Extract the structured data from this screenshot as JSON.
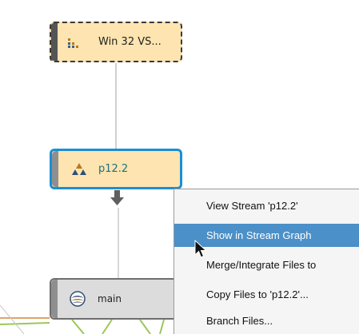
{
  "graph": {
    "nodes": [
      {
        "id": "win32",
        "label": "Win 32 VS...",
        "icon": "stream-workspace-icon"
      },
      {
        "id": "p12",
        "label": "p12.2",
        "icon": "stream-development-icon"
      },
      {
        "id": "main",
        "label": "main",
        "icon": "stream-mainline-icon"
      }
    ],
    "colors": {
      "node_fill": "#fde4b0",
      "selected_border": "#1a8fd6",
      "main_fill": "#dcdcdc",
      "menu_highlight": "#4b90c8"
    }
  },
  "context_menu": {
    "items": [
      {
        "label": "View Stream 'p12.2'"
      },
      {
        "label": "Show in Stream Graph",
        "selected": true
      },
      {
        "label": "Merge/Integrate Files to"
      },
      {
        "label": "Copy Files to 'p12.2'..."
      },
      {
        "label": "Branch Files..."
      }
    ]
  }
}
